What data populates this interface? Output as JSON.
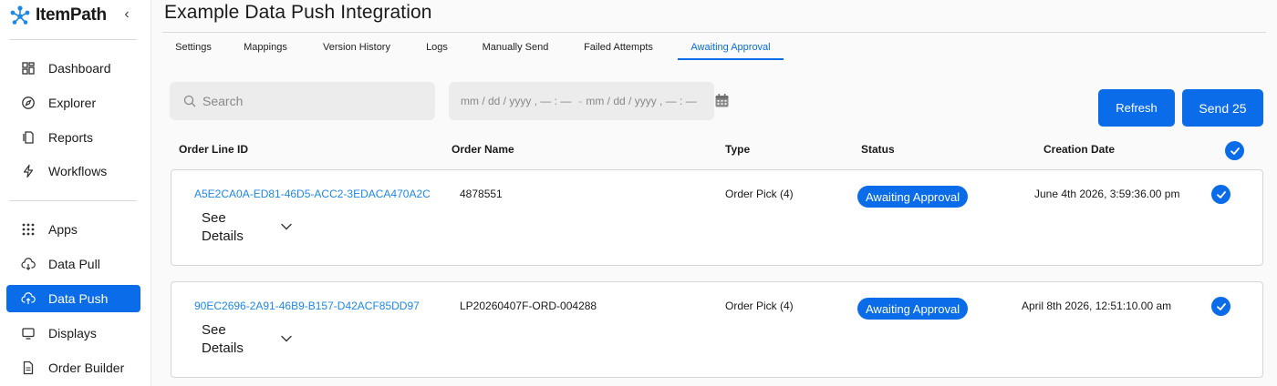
{
  "app": {
    "name": "ItemPath",
    "collapse_glyph": "‹"
  },
  "sidebar": {
    "items": [
      {
        "label": "Dashboard",
        "icon": "dashboard-icon"
      },
      {
        "label": "Explorer",
        "icon": "compass-icon"
      },
      {
        "label": "Reports",
        "icon": "report-icon"
      },
      {
        "label": "Workflows",
        "icon": "lightning-icon"
      },
      {
        "label": "Apps",
        "icon": "apps-grid-icon"
      },
      {
        "label": "Data Pull",
        "icon": "cloud-download-icon"
      },
      {
        "label": "Data Push",
        "icon": "cloud-upload-icon",
        "active": true
      },
      {
        "label": "Displays",
        "icon": "monitor-icon"
      },
      {
        "label": "Order Builder",
        "icon": "document-icon"
      }
    ]
  },
  "page": {
    "title": "Example Data Push Integration"
  },
  "tabs": [
    {
      "label": "Settings"
    },
    {
      "label": "Mappings"
    },
    {
      "label": "Version History"
    },
    {
      "label": "Logs"
    },
    {
      "label": "Manually Send"
    },
    {
      "label": "Failed Attempts"
    },
    {
      "label": "Awaiting Approval",
      "active": true
    }
  ],
  "filters": {
    "search_placeholder": "Search",
    "date_start_placeholder": "mm / dd / yyyy ,  — : —",
    "date_separator": "-",
    "date_end_placeholder": "mm / dd / yyyy ,  — : —"
  },
  "actions": {
    "refresh_label": "Refresh",
    "send_label": "Send 25"
  },
  "table": {
    "headers": {
      "order_line_id": "Order Line ID",
      "order_name": "Order Name",
      "type": "Type",
      "status": "Status",
      "creation_date": "Creation Date"
    },
    "select_all_checked": true,
    "rows": [
      {
        "order_line_id": "A5E2CA0A-ED81-46D5-ACC2-3EDACA470A2C",
        "order_name": "4878551",
        "type": "Order Pick (4)",
        "status": "Awaiting Approval",
        "creation_date": "June 4th 2026, 3:59:36.00 pm",
        "details_label": "See Details",
        "checked": true
      },
      {
        "order_line_id": "90EC2696-2A91-46B9-B157-D42ACF85DD97",
        "order_name": "LP20260407F-ORD-004288",
        "type": "Order Pick (4)",
        "status": "Awaiting Approval",
        "creation_date": "April 8th 2026, 12:51:10.00 am",
        "details_label": "See Details",
        "checked": true
      }
    ]
  },
  "colors": {
    "accent": "#0a6ce8",
    "link": "#1e88e5",
    "input_bg": "#ececec"
  }
}
